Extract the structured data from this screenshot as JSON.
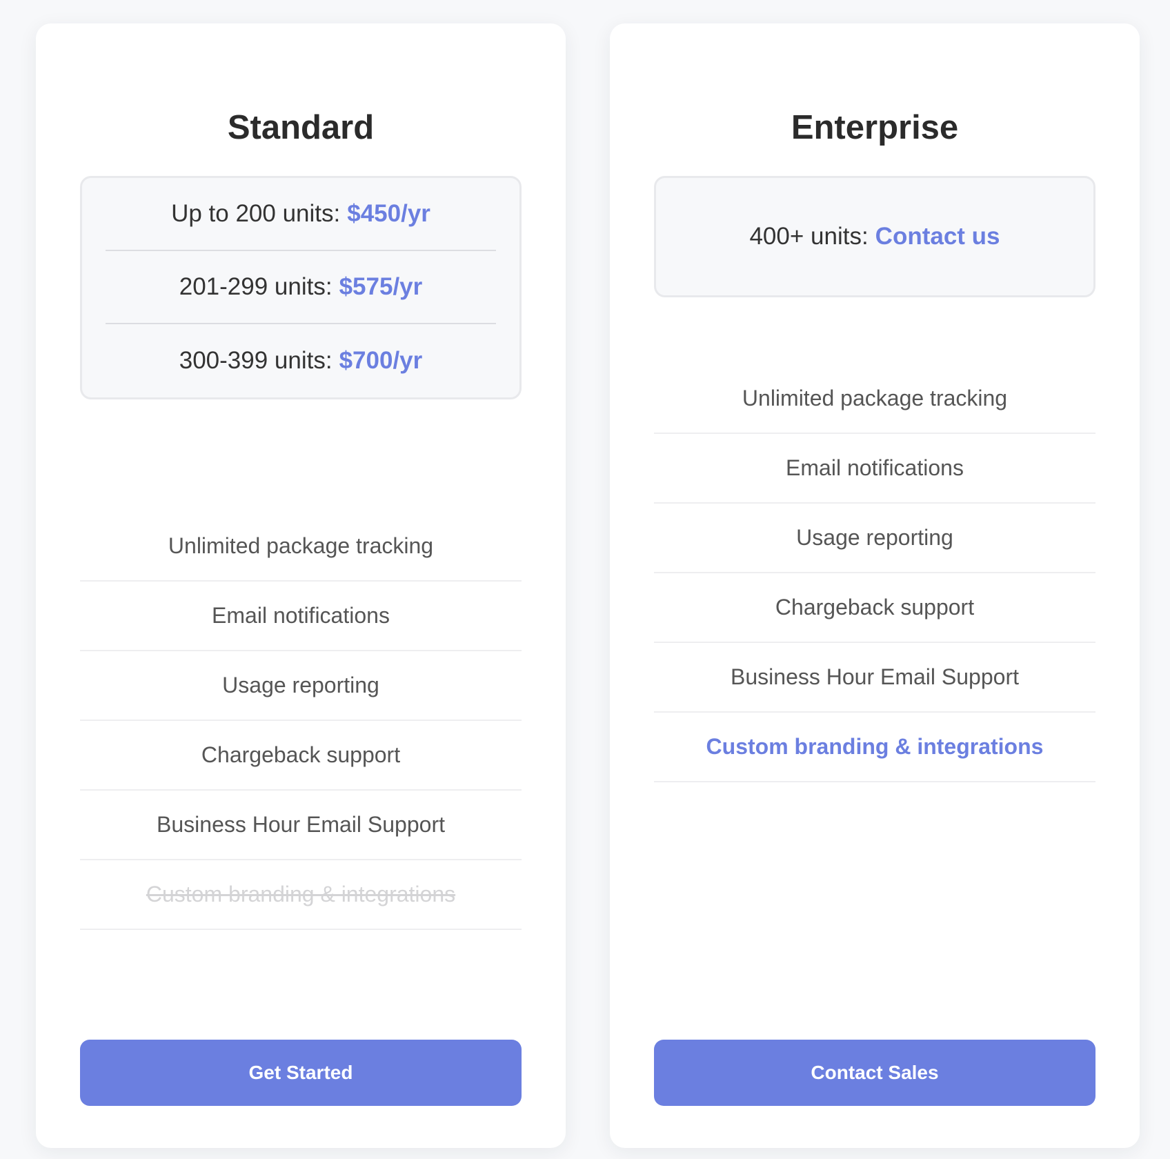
{
  "plans": [
    {
      "title": "Standard",
      "prices": [
        {
          "label": "Up to 200 units:",
          "amount": "$450/yr"
        },
        {
          "label": "201-299 units:",
          "amount": "$575/yr"
        },
        {
          "label": "300-399 units:",
          "amount": "$700/yr"
        }
      ],
      "features": [
        {
          "label": "Unlimited package tracking",
          "state": "included"
        },
        {
          "label": "Email notifications",
          "state": "included"
        },
        {
          "label": "Usage reporting",
          "state": "included"
        },
        {
          "label": "Chargeback support",
          "state": "included"
        },
        {
          "label": "Business Hour Email Support",
          "state": "included"
        },
        {
          "label": "Custom branding & integrations",
          "state": "excluded"
        }
      ],
      "cta_label": "Get Started"
    },
    {
      "title": "Enterprise",
      "prices": [
        {
          "label": "400+ units:",
          "amount": "Contact us"
        }
      ],
      "features": [
        {
          "label": "Unlimited package tracking",
          "state": "included"
        },
        {
          "label": "Email notifications",
          "state": "included"
        },
        {
          "label": "Usage reporting",
          "state": "included"
        },
        {
          "label": "Chargeback support",
          "state": "included"
        },
        {
          "label": "Business Hour Email Support",
          "state": "included"
        },
        {
          "label": "Custom branding & integrations",
          "state": "highlighted"
        }
      ],
      "cta_label": "Contact Sales"
    }
  ],
  "colors": {
    "accent": "#6b7fe0",
    "background": "#f7f8fa",
    "card": "#ffffff",
    "title": "#2b2b2b",
    "feature_text": "#555555",
    "feature_disabled": "#d4d4d6"
  }
}
